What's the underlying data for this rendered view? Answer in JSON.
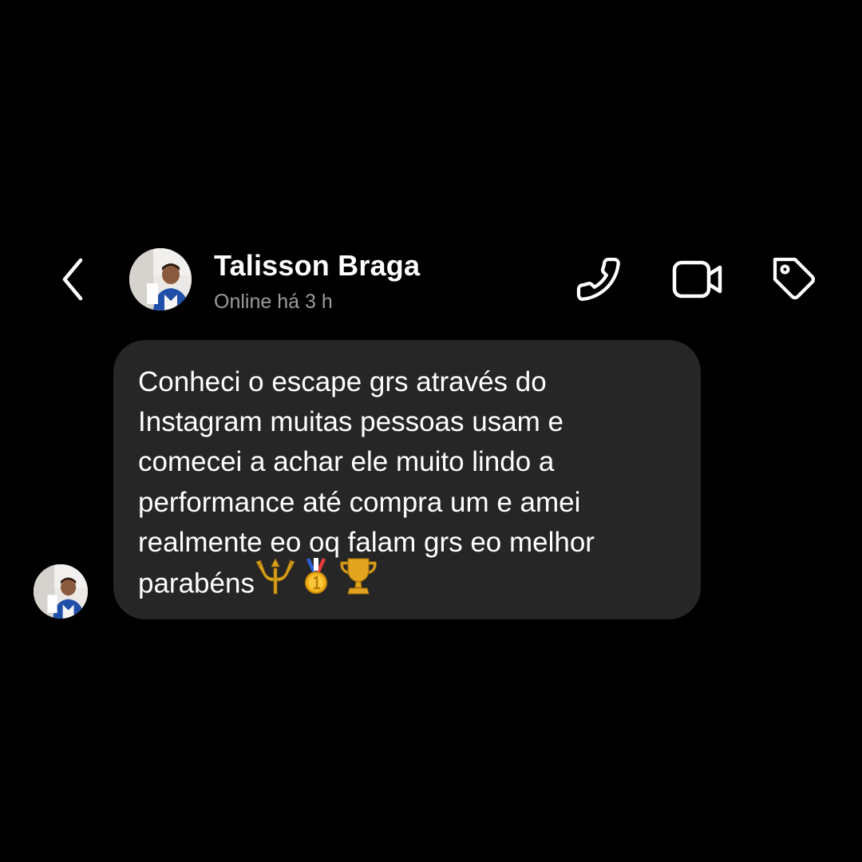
{
  "header": {
    "contact_name": "Talisson Braga",
    "status": "Online há 3 h"
  },
  "icons": {
    "back": "chevron-left-icon",
    "call": "phone-icon",
    "video": "video-camera-icon",
    "tag": "tag-icon"
  },
  "message": {
    "lines": [
      "Conheci o escape grs através do",
      "Instagram muitas pessoas usam e",
      "comecei a achar ele muito lindo a",
      "performance até compra um e amei",
      "realmente eo oq falam grs eo melhor",
      "parabéns"
    ],
    "emojis": [
      "trident-emoji",
      "gold-medal-emoji",
      "trophy-emoji"
    ]
  },
  "colors": {
    "background": "#000000",
    "bubble": "#262626",
    "text": "#ffffff",
    "status_text": "#9a9a9a"
  }
}
